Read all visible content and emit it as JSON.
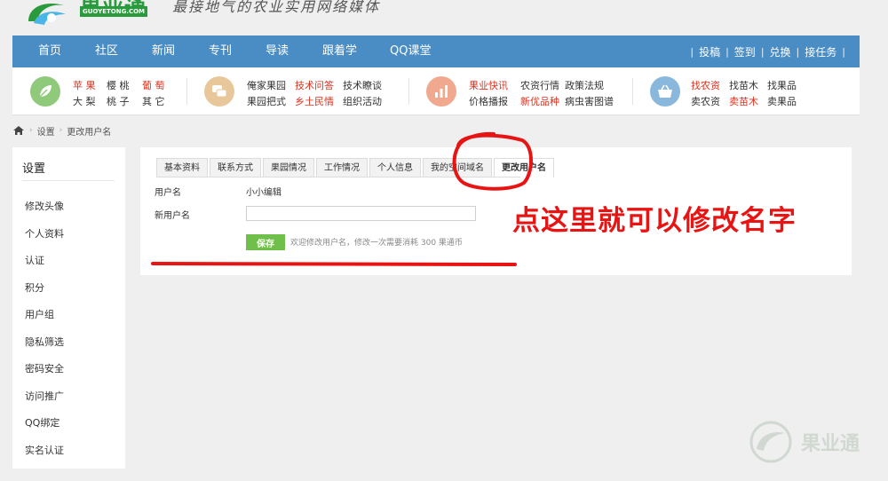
{
  "header": {
    "logo_name": "果业通",
    "logo_domain": "GUOYETONG.COM",
    "slogan": "最接地气的农业实用网络媒体"
  },
  "nav": {
    "items": [
      "首页",
      "社区",
      "新闻",
      "专刊",
      "导读",
      "跟着学",
      "QQ课堂"
    ],
    "actions": [
      "投稿",
      "签到",
      "兑换",
      "接任务"
    ]
  },
  "categories": {
    "group1": {
      "icon": "leaf-icon",
      "color": "#8fc97a",
      "row1": [
        "苹 果",
        "樱 桃",
        "葡 萄"
      ],
      "row2": [
        "大 梨",
        "桃 子",
        "其 它"
      ]
    },
    "group2": {
      "icon": "chat-icon",
      "color": "#e8c79a",
      "row1": [
        "俺家果园",
        "技术问答",
        "技术瞭谈"
      ],
      "row2": [
        "果园把式",
        "乡土民情",
        "组织活动"
      ]
    },
    "group3": {
      "icon": "chart-icon",
      "color": "#f0a98f",
      "row1": [
        "果业快讯",
        "农资行情",
        "政策法规"
      ],
      "row2": [
        "价格播报",
        "新优品种",
        "病虫害图谱"
      ]
    },
    "group4": {
      "icon": "basket-icon",
      "color": "#8ab8dc",
      "row1": [
        "找农资",
        "找苗木",
        "找果品"
      ],
      "row2": [
        "卖农资",
        "卖苗木",
        "卖果品"
      ]
    }
  },
  "breadcrumb": {
    "home_icon": "home-icon",
    "items": [
      "设置",
      "更改用户名"
    ]
  },
  "sidebar": {
    "title": "设置",
    "items": [
      "修改头像",
      "个人资料",
      "认证",
      "积分",
      "用户组",
      "隐私筛选",
      "密码安全",
      "访问推广",
      "QQ绑定",
      "实名认证"
    ]
  },
  "tabs": [
    "基本资料",
    "联系方式",
    "果园情况",
    "工作情况",
    "个人信息",
    "我的空间域名",
    "更改用户名"
  ],
  "active_tab": "更改用户名",
  "form": {
    "username_label": "用户名",
    "username_value": "小小编辑",
    "new_username_label": "新用户名",
    "new_username_value": "",
    "save_label": "保存",
    "hint": "欢迎修改用户名，修改一次需要消耗 300 果通币"
  },
  "annotation": {
    "text": "点这里就可以修改名字",
    "color": "#e81414"
  },
  "watermark": {
    "text": "果业通"
  },
  "colors": {
    "nav_bg": "#4a8cc4",
    "brand_green": "#2a9b3c",
    "save_green": "#6fbf4a",
    "link_red": "#e0301e"
  }
}
